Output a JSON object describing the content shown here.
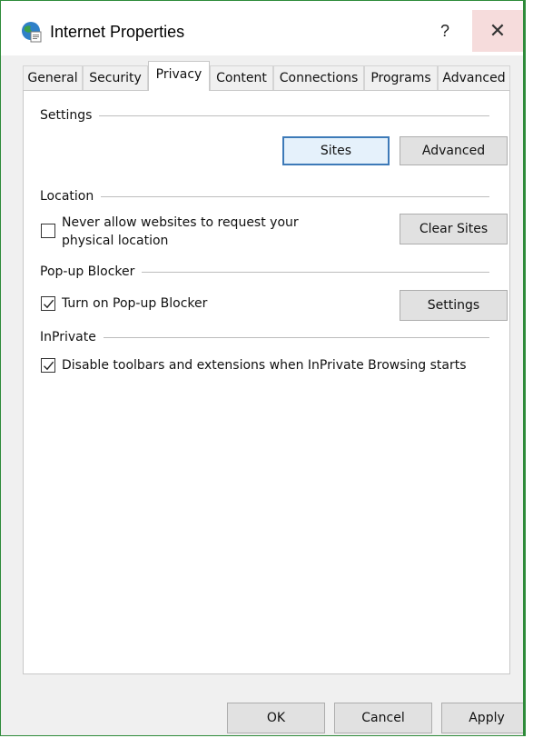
{
  "window": {
    "title": "Internet Properties",
    "help_glyph": "?",
    "close_glyph": "✕",
    "icon": "internet-globe-icon"
  },
  "tabs": [
    {
      "label": "General"
    },
    {
      "label": "Security"
    },
    {
      "label": "Privacy",
      "active": true
    },
    {
      "label": "Content"
    },
    {
      "label": "Connections"
    },
    {
      "label": "Programs"
    },
    {
      "label": "Advanced"
    }
  ],
  "settings": {
    "header": "Settings",
    "sites_button": "Sites",
    "advanced_button": "Advanced"
  },
  "location": {
    "header": "Location",
    "never_allow_line1": "Never allow websites to request your",
    "never_allow_line2": "physical location",
    "never_allow_checked": false,
    "clear_sites_button": "Clear Sites"
  },
  "popup": {
    "header": "Pop-up Blocker",
    "turn_on_label": "Turn on Pop-up Blocker",
    "turn_on_checked": true,
    "settings_button": "Settings"
  },
  "inprivate": {
    "header": "InPrivate",
    "disable_label": "Disable toolbars and extensions when InPrivate Browsing starts",
    "disable_checked": true
  },
  "footer": {
    "ok": "OK",
    "cancel": "Cancel",
    "apply": "Apply"
  }
}
